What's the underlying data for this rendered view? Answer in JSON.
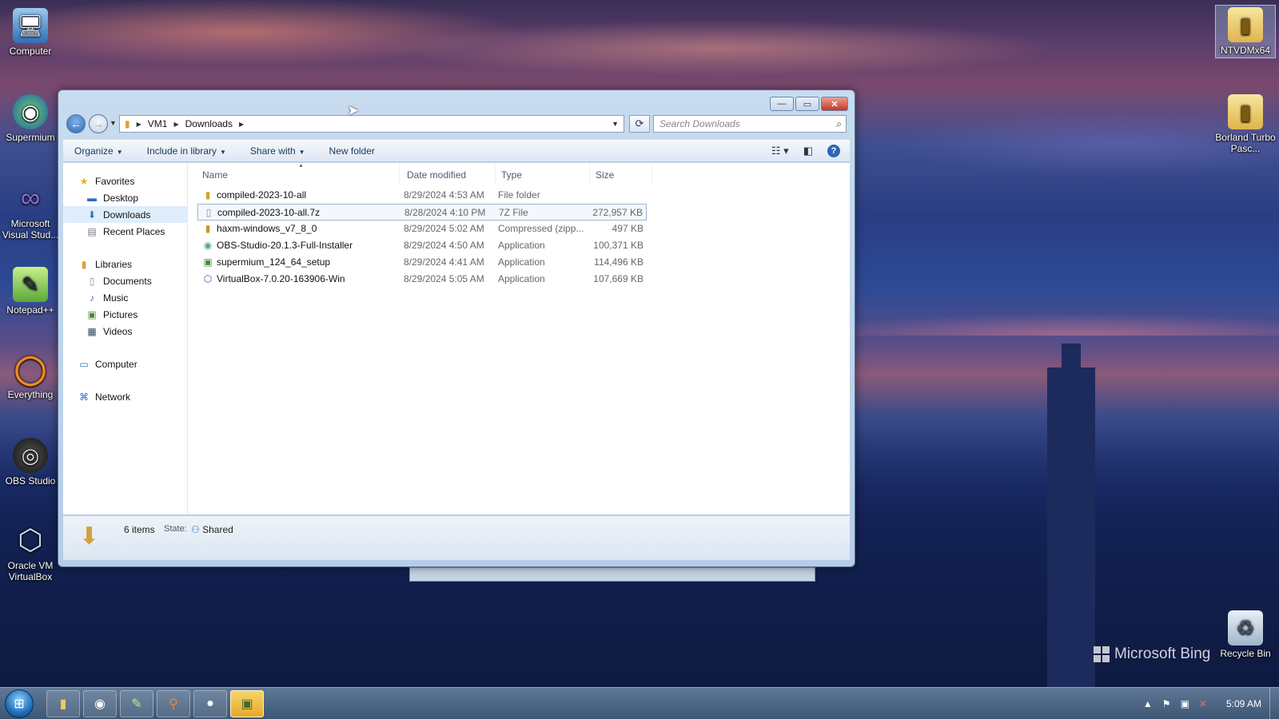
{
  "desktop": {
    "icons_left": [
      {
        "label": "Computer",
        "icon": "computer-icon",
        "glyph": "🖥"
      },
      {
        "label": "Supermium",
        "icon": "supermium-icon",
        "glyph": "◉"
      },
      {
        "label": "Microsoft Visual Stud...",
        "icon": "visual-studio-icon",
        "glyph": "∞"
      },
      {
        "label": "Notepad++",
        "icon": "notepadpp-icon",
        "glyph": "✎"
      },
      {
        "label": "Everything",
        "icon": "everything-icon",
        "glyph": "◯"
      },
      {
        "label": "OBS Studio",
        "icon": "obs-icon",
        "glyph": "◎"
      },
      {
        "label": "Oracle VM VirtualBox",
        "icon": "virtualbox-icon",
        "glyph": "⬡"
      }
    ],
    "icons_right": [
      {
        "label": "NTVDMx64",
        "icon": "folder-icon",
        "glyph": "📁"
      },
      {
        "label": "Borland Turbo Pasc...",
        "icon": "folder-icon",
        "glyph": "📁"
      },
      {
        "label": "Recycle Bin",
        "icon": "recycle-bin-icon",
        "glyph": "🗑"
      }
    ],
    "watermark": "Microsoft Bing"
  },
  "explorer": {
    "breadcrumb": [
      "VM1",
      "Downloads"
    ],
    "search_placeholder": "Search Downloads",
    "toolbar": {
      "organize": "Organize",
      "include": "Include in library",
      "share": "Share with",
      "new_folder": "New folder"
    },
    "nav": {
      "favorites": "Favorites",
      "desktop": "Desktop",
      "downloads": "Downloads",
      "recent": "Recent Places",
      "libraries": "Libraries",
      "documents": "Documents",
      "music": "Music",
      "pictures": "Pictures",
      "videos": "Videos",
      "computer": "Computer",
      "network": "Network"
    },
    "columns": {
      "name": "Name",
      "date": "Date modified",
      "type": "Type",
      "size": "Size"
    },
    "files": [
      {
        "name": "compiled-2023-10-all",
        "date": "8/29/2024 4:53 AM",
        "type": "File folder",
        "size": "",
        "icon": "folder-icon"
      },
      {
        "name": "compiled-2023-10-all.7z",
        "date": "8/28/2024 4:10 PM",
        "type": "7Z File",
        "size": "272,957 KB",
        "icon": "file-icon"
      },
      {
        "name": "haxm-windows_v7_8_0",
        "date": "8/29/2024 5:02 AM",
        "type": "Compressed (zipp...",
        "size": "497 KB",
        "icon": "zip-folder-icon"
      },
      {
        "name": "OBS-Studio-20.1.3-Full-Installer",
        "date": "8/29/2024 4:50 AM",
        "type": "Application",
        "size": "100,371 KB",
        "icon": "installer-icon"
      },
      {
        "name": "supermium_124_64_setup",
        "date": "8/29/2024 4:41 AM",
        "type": "Application",
        "size": "114,496 KB",
        "icon": "setup-icon"
      },
      {
        "name": "VirtualBox-7.0.20-163906-Win",
        "date": "8/29/2024 5:05 AM",
        "type": "Application",
        "size": "107,669 KB",
        "icon": "virtualbox-icon"
      }
    ],
    "details": {
      "count": "6 items",
      "state_label": "State:",
      "state_value": "Shared"
    }
  },
  "taskbar": {
    "clock": "5:09 AM"
  }
}
